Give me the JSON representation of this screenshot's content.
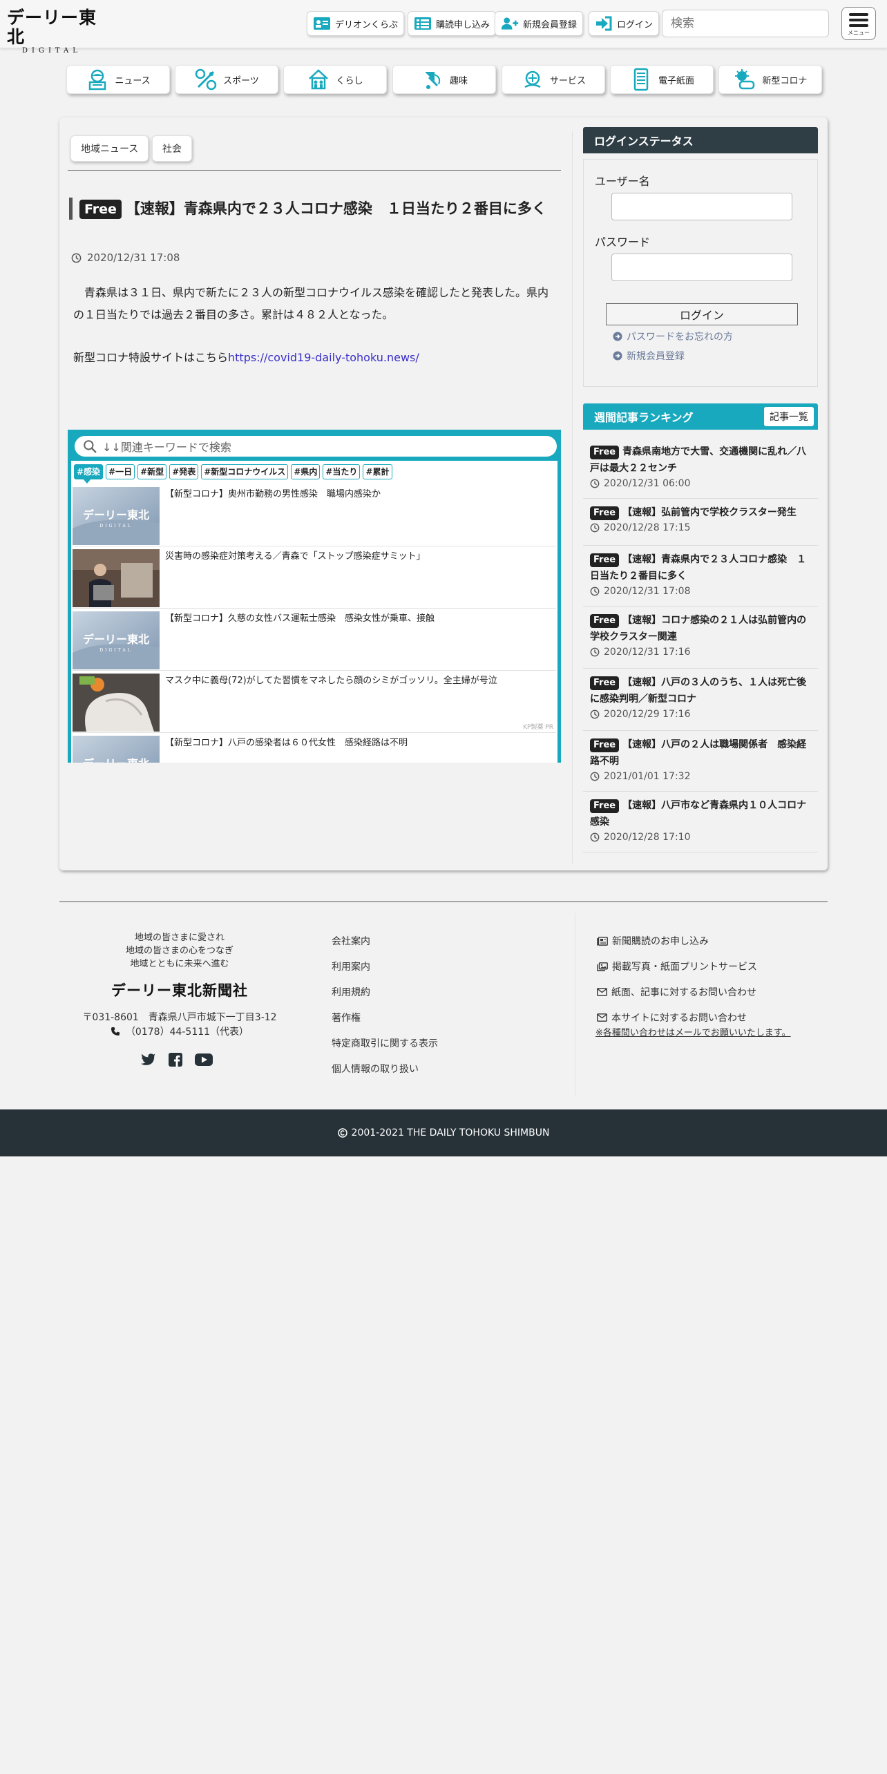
{
  "header": {
    "logo_main": "デーリー東北",
    "logo_sub": "DIGITAL",
    "buttons": [
      {
        "label": "デリオンくらぶ",
        "icon": "id-card-icon"
      },
      {
        "label": "購読申し込み",
        "icon": "newspaper-list-icon"
      },
      {
        "label": "新規会員登録",
        "icon": "user-plus-icon"
      },
      {
        "label": "ログイン",
        "icon": "sign-in-icon"
      }
    ],
    "search_placeholder": "検索",
    "menu_label": "メニュー"
  },
  "categories": [
    {
      "label": "ニュース",
      "icon": "news-reader-icon"
    },
    {
      "label": "スポーツ",
      "icon": "sports-balls-icon"
    },
    {
      "label": "くらし",
      "icon": "house-family-icon"
    },
    {
      "label": "趣味",
      "icon": "hobby-icon"
    },
    {
      "label": "サービス",
      "icon": "service-icon"
    },
    {
      "label": "電子紙面",
      "icon": "tablet-icon"
    },
    {
      "label": "新型コロナ",
      "icon": "virus-icon"
    }
  ],
  "breadcrumb_tags": [
    "地域ニュース",
    "社会"
  ],
  "article": {
    "badge": "Free",
    "title": "【速報】青森県内で２３人コロナ感染　１日当たり２番目に多く",
    "date": "2020/12/31 17:08",
    "body": "青森県は３１日、県内で新たに２３人の新型コロナウイルス感染を確認したと発表した。県内の１日当たりでは過去２番目の多さ。累計は４８２人となった。",
    "link_prefix": "新型コロナ特設サイトはこちら",
    "link_url": "https://covid19-daily-tohoku.news/"
  },
  "related": {
    "search_placeholder": "↓↓関連キーワードで検索",
    "keywords": [
      "#感染",
      "#一日",
      "#新型",
      "#発表",
      "#新型コロナウイルス",
      "#県内",
      "#当たり",
      "#累計"
    ],
    "items": [
      {
        "title": "【新型コロナ】奥州市勤務の男性感染　職場内感染か",
        "thumb": "logo",
        "pr": ""
      },
      {
        "title": "災害時の感染症対策考える／青森で「ストップ感染症サミット」",
        "thumb": "speaker",
        "pr": ""
      },
      {
        "title": "【新型コロナ】久慈の女性バス運転士感染　感染女性が乗車、接触",
        "thumb": "logo",
        "pr": ""
      },
      {
        "title": "マスク中に義母(72)がしてた習慣をマネしたら顔のシミがゴッソリ。全主婦が号泣",
        "thumb": "ad",
        "pr": "KP製薬 PR"
      },
      {
        "title": "【新型コロナ】八戸の感染者は６０代女性　感染経路は不明",
        "thumb": "logo",
        "pr": ""
      }
    ],
    "thumb_logo_text": "デーリー東北",
    "thumb_logo_sub": "DIGITAL"
  },
  "sidebar": {
    "login_title": "ログインステータス",
    "username_label": "ユーザー名",
    "password_label": "パスワード",
    "login_button": "ログイン",
    "forgot_link": "パスワードをお忘れの方",
    "register_link": "新規会員登録",
    "ranking_title": "週間記事ランキング",
    "ranking_all": "記事一覧",
    "ranking": [
      {
        "badge": "Free",
        "title": "青森県南地方で大雪、交通機関に乱れ／八戸は最大２２センチ",
        "date": "2020/12/31 06:00"
      },
      {
        "badge": "Free",
        "title": "【速報】弘前管内で学校クラスター発生",
        "date": "2020/12/28 17:15"
      },
      {
        "badge": "Free",
        "title": "【速報】青森県内で２３人コロナ感染　１日当たり２番目に多く",
        "date": "2020/12/31 17:08"
      },
      {
        "badge": "Free",
        "title": "【速報】コロナ感染の２１人は弘前管内の学校クラスター関連",
        "date": "2020/12/31 17:16"
      },
      {
        "badge": "Free",
        "title": "【速報】八戸の３人のうち、１人は死亡後に感染判明／新型コロナ",
        "date": "2020/12/29 17:16"
      },
      {
        "badge": "Free",
        "title": "【速報】八戸の２人は職場関係者　感染経路不明",
        "date": "2021/01/01 17:32"
      },
      {
        "badge": "Free",
        "title": "【速報】八戸市など青森県内１０人コロナ感染",
        "date": "2020/12/28 17:10"
      }
    ]
  },
  "footer": {
    "slogan": [
      "地域の皆さまに愛され",
      "地域の皆さまの心をつなぎ",
      "地域とともに未来へ進む"
    ],
    "corp_name": "デーリー東北新聞社",
    "address": "〒031-8601　青森県八戸市城下一丁目3-12",
    "tel": "（0178）44-5111（代表）",
    "social": [
      "twitter-icon",
      "facebook-icon",
      "youtube-icon"
    ],
    "links": [
      "会社案内",
      "利用案内",
      "利用規約",
      "著作権",
      "特定商取引に関する表示",
      "個人情報の取り扱い"
    ],
    "right_links": [
      {
        "label": "新聞購読のお申し込み",
        "icon": "newspaper-icon"
      },
      {
        "label": "掲載写真・紙面プリントサービス",
        "icon": "photos-icon"
      },
      {
        "label": "紙面、記事に対するお問い合わせ",
        "icon": "envelope-icon"
      },
      {
        "label": "本サイトに対するお問い合わせ",
        "icon": "envelope-icon"
      }
    ],
    "note": "※各種問い合わせはメールでお願いいたします。",
    "copyright": "2001-2021 THE DAILY TOHOKU SHIMBUN"
  },
  "colors": {
    "accent": "#18a9bf",
    "dark": "#2f3d45",
    "footer_bg": "#263238",
    "link": "#3a2fc8"
  }
}
